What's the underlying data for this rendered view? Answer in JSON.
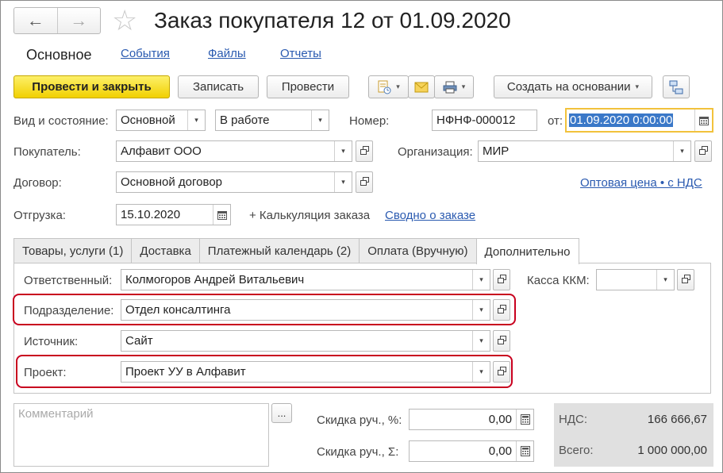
{
  "window": {
    "title": "Заказ покупателя 12 от 01.09.2020"
  },
  "nav_tabs": [
    "Основное",
    "События",
    "Файлы",
    "Отчеты"
  ],
  "toolbar": {
    "post_close": "Провести и закрыть",
    "save": "Записать",
    "post": "Провести",
    "create_based": "Создать на основании"
  },
  "header": {
    "kind_state_label": "Вид и состояние:",
    "kind_value": "Основной",
    "state_value": "В работе",
    "number_label": "Номер:",
    "number_value": "НФНФ-000012",
    "date_label": "от:",
    "date_value": "01.09.2020  0:00:00",
    "buyer_label": "Покупатель:",
    "buyer_value": "Алфавит ООО",
    "org_label": "Организация:",
    "org_value": "МИР",
    "contract_label": "Договор:",
    "contract_value": "Основной договор",
    "price_link": "Оптовая цена • с НДС",
    "shipment_label": "Отгрузка:",
    "shipment_value": "15.10.2020",
    "calc_text": "+ Калькуляция заказа",
    "summary_link": "Сводно о заказе"
  },
  "doc_tabs": [
    "Товары, услуги (1)",
    "Доставка",
    "Платежный календарь (2)",
    "Оплата (Вручную)",
    "Дополнительно"
  ],
  "additional": {
    "responsible_label": "Ответственный:",
    "responsible_value": "Колмогоров Андрей Витальевич",
    "kkm_label": "Касса ККМ:",
    "kkm_value": "",
    "department_label": "Подразделение:",
    "department_value": "Отдел консалтинга",
    "source_label": "Источник:",
    "source_value": "Сайт",
    "project_label": "Проект:",
    "project_value": "Проект УУ в Алфавит"
  },
  "footer": {
    "comment_placeholder": "Комментарий",
    "comment_more": "...",
    "discount_pct_label": "Скидка руч., %:",
    "discount_pct_value": "0,00",
    "discount_sum_label": "Скидка руч., Σ:",
    "discount_sum_value": "0,00",
    "vat_label": "НДС:",
    "vat_value": "166 666,67",
    "total_label": "Всего:",
    "total_value": "1 000 000,00"
  },
  "colors": {
    "accent": "#f1d000",
    "link": "#2a5ab0",
    "highlight": "#c8001e",
    "selection": "#3a78c8"
  }
}
